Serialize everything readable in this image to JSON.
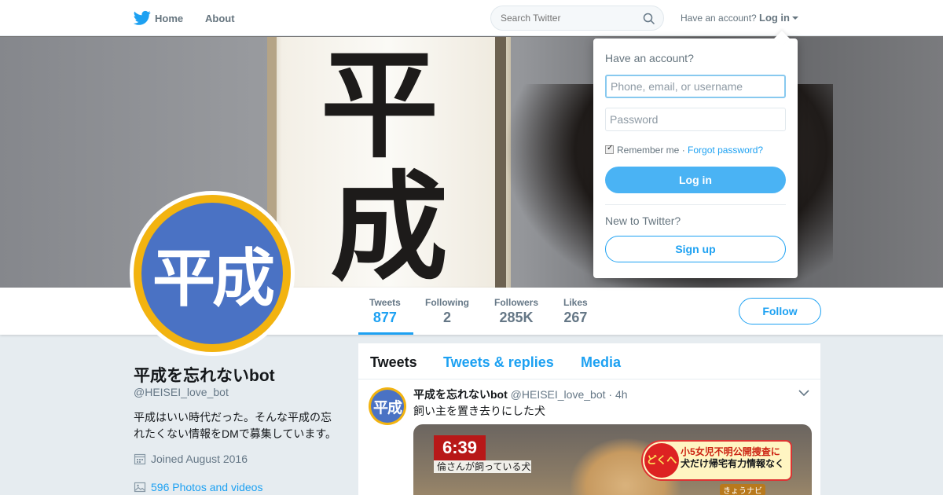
{
  "nav": {
    "logo_icon": "twitter-bird-icon",
    "home": "Home",
    "about": "About",
    "search_placeholder": "Search Twitter",
    "have_account": "Have an account?",
    "login": "Log in"
  },
  "banner": {
    "kanji_top": "平",
    "kanji_bottom": "成"
  },
  "profile": {
    "avatar_text": "平成",
    "name": "平成を忘れないbot",
    "handle": "@HEISEI_love_bot",
    "bio": "平成はいい時代だった。そんな平成の忘れたくない情報をDMで募集しています。",
    "joined": "Joined August 2016",
    "photos": "596 Photos and videos"
  },
  "stats": [
    {
      "label": "Tweets",
      "value": "877"
    },
    {
      "label": "Following",
      "value": "2"
    },
    {
      "label": "Followers",
      "value": "285K"
    },
    {
      "label": "Likes",
      "value": "267"
    }
  ],
  "follow_button": "Follow",
  "timeline": {
    "tabs": [
      "Tweets",
      "Tweets & replies",
      "Media"
    ],
    "tweet": {
      "avatar_text": "平成",
      "name": "平成を忘れないbot",
      "handle": "@HEISEI_love_bot",
      "time": "· 4h",
      "text": "飼い主を置き去りにした犬",
      "media": {
        "time": "6:39",
        "caption": "倫さんが飼っている犬",
        "badge_circle": "どくへ",
        "badge_line1_a": "小5女児不明",
        "badge_line1_b": "公開捜査に",
        "badge_line2_a": "犬だけ帰宅",
        "badge_line2_b": "有力情報なく",
        "tag": "きょうナビ"
      }
    }
  },
  "login_dropdown": {
    "title": "Have an account?",
    "username_placeholder": "Phone, email, or username",
    "password_placeholder": "Password",
    "remember": "Remember me",
    "separator": "·",
    "forgot": "Forgot password?",
    "login_button": "Log in",
    "new_to_twitter": "New to Twitter?",
    "signup_button": "Sign up"
  },
  "colors": {
    "accent": "#1da1f2",
    "login_button": "#4ab3f4",
    "avatar_ring": "#f2b310",
    "avatar_fill": "#4a72c4"
  }
}
